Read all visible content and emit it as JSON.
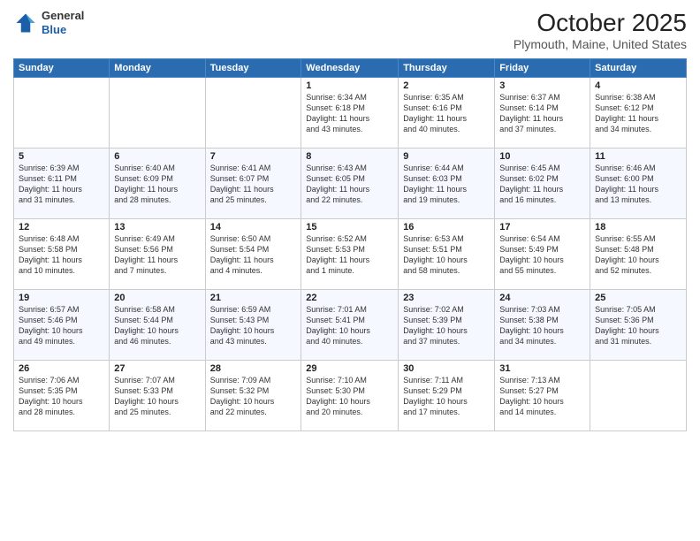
{
  "header": {
    "logo_general": "General",
    "logo_blue": "Blue",
    "month": "October 2025",
    "location": "Plymouth, Maine, United States"
  },
  "weekdays": [
    "Sunday",
    "Monday",
    "Tuesday",
    "Wednesday",
    "Thursday",
    "Friday",
    "Saturday"
  ],
  "weeks": [
    [
      {
        "day": "",
        "info": ""
      },
      {
        "day": "",
        "info": ""
      },
      {
        "day": "",
        "info": ""
      },
      {
        "day": "1",
        "info": "Sunrise: 6:34 AM\nSunset: 6:18 PM\nDaylight: 11 hours\nand 43 minutes."
      },
      {
        "day": "2",
        "info": "Sunrise: 6:35 AM\nSunset: 6:16 PM\nDaylight: 11 hours\nand 40 minutes."
      },
      {
        "day": "3",
        "info": "Sunrise: 6:37 AM\nSunset: 6:14 PM\nDaylight: 11 hours\nand 37 minutes."
      },
      {
        "day": "4",
        "info": "Sunrise: 6:38 AM\nSunset: 6:12 PM\nDaylight: 11 hours\nand 34 minutes."
      }
    ],
    [
      {
        "day": "5",
        "info": "Sunrise: 6:39 AM\nSunset: 6:11 PM\nDaylight: 11 hours\nand 31 minutes."
      },
      {
        "day": "6",
        "info": "Sunrise: 6:40 AM\nSunset: 6:09 PM\nDaylight: 11 hours\nand 28 minutes."
      },
      {
        "day": "7",
        "info": "Sunrise: 6:41 AM\nSunset: 6:07 PM\nDaylight: 11 hours\nand 25 minutes."
      },
      {
        "day": "8",
        "info": "Sunrise: 6:43 AM\nSunset: 6:05 PM\nDaylight: 11 hours\nand 22 minutes."
      },
      {
        "day": "9",
        "info": "Sunrise: 6:44 AM\nSunset: 6:03 PM\nDaylight: 11 hours\nand 19 minutes."
      },
      {
        "day": "10",
        "info": "Sunrise: 6:45 AM\nSunset: 6:02 PM\nDaylight: 11 hours\nand 16 minutes."
      },
      {
        "day": "11",
        "info": "Sunrise: 6:46 AM\nSunset: 6:00 PM\nDaylight: 11 hours\nand 13 minutes."
      }
    ],
    [
      {
        "day": "12",
        "info": "Sunrise: 6:48 AM\nSunset: 5:58 PM\nDaylight: 11 hours\nand 10 minutes."
      },
      {
        "day": "13",
        "info": "Sunrise: 6:49 AM\nSunset: 5:56 PM\nDaylight: 11 hours\nand 7 minutes."
      },
      {
        "day": "14",
        "info": "Sunrise: 6:50 AM\nSunset: 5:54 PM\nDaylight: 11 hours\nand 4 minutes."
      },
      {
        "day": "15",
        "info": "Sunrise: 6:52 AM\nSunset: 5:53 PM\nDaylight: 11 hours\nand 1 minute."
      },
      {
        "day": "16",
        "info": "Sunrise: 6:53 AM\nSunset: 5:51 PM\nDaylight: 10 hours\nand 58 minutes."
      },
      {
        "day": "17",
        "info": "Sunrise: 6:54 AM\nSunset: 5:49 PM\nDaylight: 10 hours\nand 55 minutes."
      },
      {
        "day": "18",
        "info": "Sunrise: 6:55 AM\nSunset: 5:48 PM\nDaylight: 10 hours\nand 52 minutes."
      }
    ],
    [
      {
        "day": "19",
        "info": "Sunrise: 6:57 AM\nSunset: 5:46 PM\nDaylight: 10 hours\nand 49 minutes."
      },
      {
        "day": "20",
        "info": "Sunrise: 6:58 AM\nSunset: 5:44 PM\nDaylight: 10 hours\nand 46 minutes."
      },
      {
        "day": "21",
        "info": "Sunrise: 6:59 AM\nSunset: 5:43 PM\nDaylight: 10 hours\nand 43 minutes."
      },
      {
        "day": "22",
        "info": "Sunrise: 7:01 AM\nSunset: 5:41 PM\nDaylight: 10 hours\nand 40 minutes."
      },
      {
        "day": "23",
        "info": "Sunrise: 7:02 AM\nSunset: 5:39 PM\nDaylight: 10 hours\nand 37 minutes."
      },
      {
        "day": "24",
        "info": "Sunrise: 7:03 AM\nSunset: 5:38 PM\nDaylight: 10 hours\nand 34 minutes."
      },
      {
        "day": "25",
        "info": "Sunrise: 7:05 AM\nSunset: 5:36 PM\nDaylight: 10 hours\nand 31 minutes."
      }
    ],
    [
      {
        "day": "26",
        "info": "Sunrise: 7:06 AM\nSunset: 5:35 PM\nDaylight: 10 hours\nand 28 minutes."
      },
      {
        "day": "27",
        "info": "Sunrise: 7:07 AM\nSunset: 5:33 PM\nDaylight: 10 hours\nand 25 minutes."
      },
      {
        "day": "28",
        "info": "Sunrise: 7:09 AM\nSunset: 5:32 PM\nDaylight: 10 hours\nand 22 minutes."
      },
      {
        "day": "29",
        "info": "Sunrise: 7:10 AM\nSunset: 5:30 PM\nDaylight: 10 hours\nand 20 minutes."
      },
      {
        "day": "30",
        "info": "Sunrise: 7:11 AM\nSunset: 5:29 PM\nDaylight: 10 hours\nand 17 minutes."
      },
      {
        "day": "31",
        "info": "Sunrise: 7:13 AM\nSunset: 5:27 PM\nDaylight: 10 hours\nand 14 minutes."
      },
      {
        "day": "",
        "info": ""
      }
    ]
  ]
}
